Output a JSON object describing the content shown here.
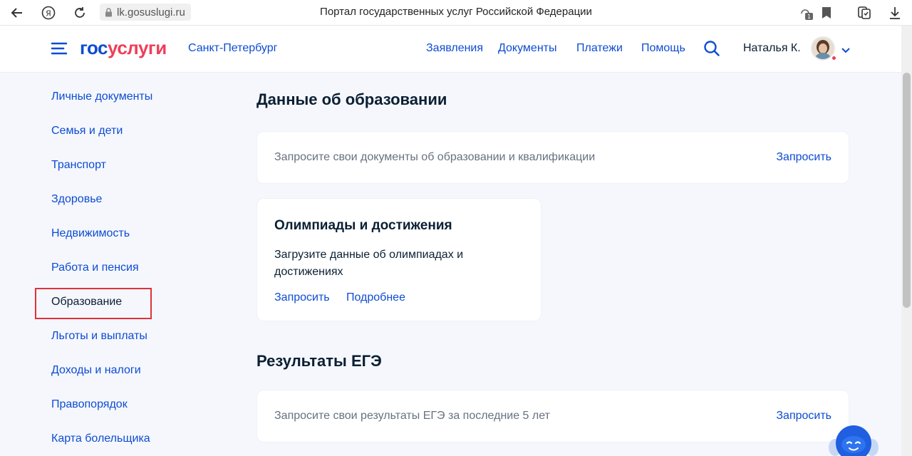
{
  "browser": {
    "url": "lk.gosuslugi.ru",
    "title": "Портал государственных услуг Российской Федерации",
    "tab_badge": "1"
  },
  "header": {
    "logo_part1": "гос",
    "logo_part2": "услуги",
    "region": "Санкт-Петербург",
    "nav": [
      "Заявления",
      "Документы",
      "Платежи",
      "Помощь"
    ],
    "user_name": "Наталья К."
  },
  "sidebar": {
    "items": [
      {
        "label": "Личные документы"
      },
      {
        "label": "Семья и дети"
      },
      {
        "label": "Транспорт"
      },
      {
        "label": "Здоровье"
      },
      {
        "label": "Недвижимость"
      },
      {
        "label": "Работа и пенсия"
      },
      {
        "label": "Образование",
        "active": true
      },
      {
        "label": "Льготы и выплаты"
      },
      {
        "label": "Доходы и налоги"
      },
      {
        "label": "Правопорядок"
      },
      {
        "label": "Карта болельщика"
      }
    ]
  },
  "main": {
    "education_title": "Данные об образовании",
    "education_card": {
      "text": "Запросите свои документы об образовании и квалификации",
      "action": "Запросить"
    },
    "olympiad_card": {
      "title": "Олимпиады и достижения",
      "text": "Загрузите данные об олимпиадах и достижениях",
      "action1": "Запросить",
      "action2": "Подробнее"
    },
    "ege_title": "Результаты ЕГЭ",
    "ege_card": {
      "text": "Запросите свои результаты ЕГЭ за последние 5 лет",
      "action": "Запросить"
    }
  },
  "colors": {
    "brand_blue": "#0d4cd3",
    "brand_red": "#ee3f58",
    "highlight": "#e0313a"
  }
}
